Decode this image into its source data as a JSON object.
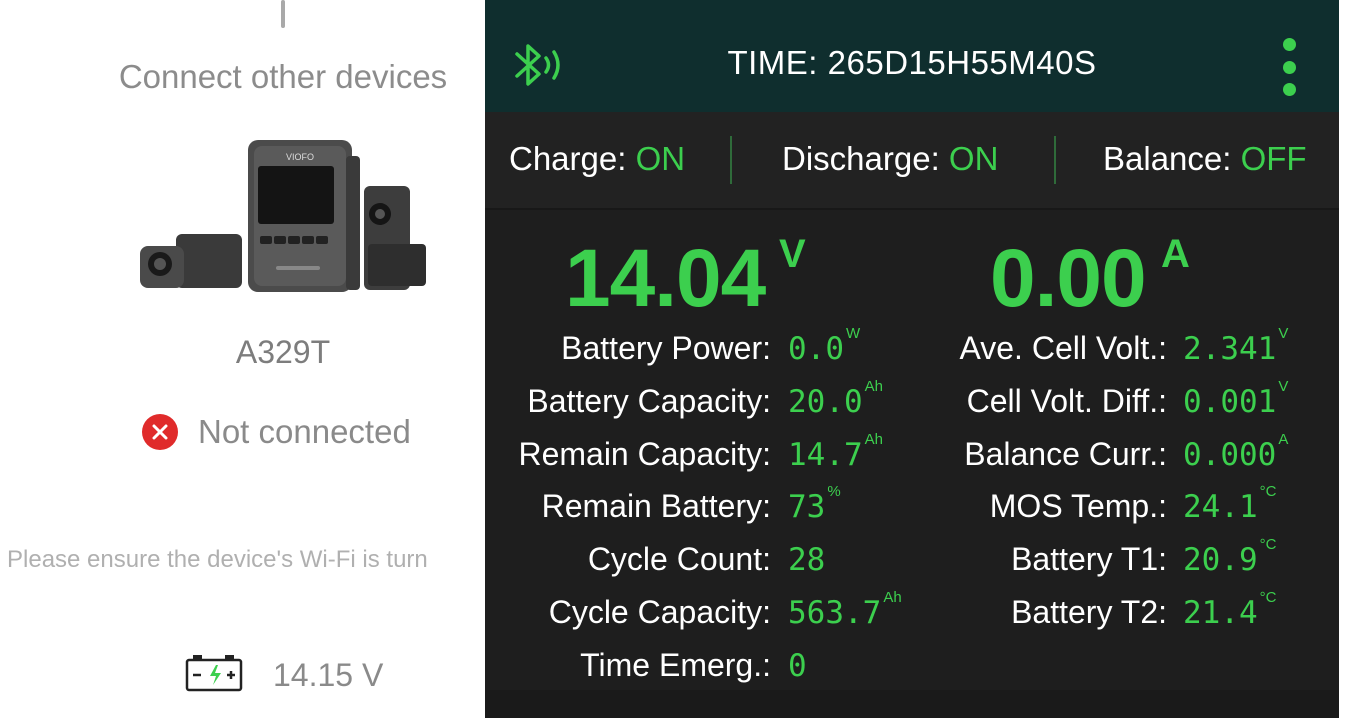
{
  "left_panel": {
    "title": "Connect other devices",
    "model": "A329T",
    "status_text": "Not connected",
    "hint": "Please ensure the device's Wi-Fi is turn",
    "battery_voltage": "14.15 V",
    "camera_brand": "VIOFO",
    "icons": [
      "close-icon",
      "car-battery-icon"
    ]
  },
  "topbar": {
    "time": "TIME: 265D15H55M40S",
    "icons": [
      "bluetooth-icon",
      "more-vert-icon"
    ]
  },
  "status_row": {
    "charge_label": "Charge:",
    "charge_value": "ON",
    "discharge_label": "Discharge:",
    "discharge_value": "ON",
    "balance_label": "Balance:",
    "balance_value": "OFF"
  },
  "readings": {
    "voltage": "14.04",
    "voltage_unit": "V",
    "current": "0.00",
    "current_unit": "A"
  },
  "left_stats": [
    {
      "label": "Battery Power:",
      "value": "0.0",
      "unit": "W"
    },
    {
      "label": "Battery Capacity:",
      "value": "20.0",
      "unit": "Ah"
    },
    {
      "label": "Remain Capacity:",
      "value": "14.7",
      "unit": "Ah"
    },
    {
      "label": "Remain Battery:",
      "value": "73",
      "unit": "%"
    },
    {
      "label": "Cycle Count:",
      "value": "28",
      "unit": ""
    },
    {
      "label": "Cycle Capacity:",
      "value": "563.7",
      "unit": "Ah"
    },
    {
      "label": "Time Emerg.:",
      "value": "0",
      "unit": ""
    }
  ],
  "right_stats": [
    {
      "label": "Ave. Cell Volt.:",
      "value": "2.341",
      "unit": "V"
    },
    {
      "label": "Cell Volt. Diff.:",
      "value": "0.001",
      "unit": "V"
    },
    {
      "label": "Balance Curr.:",
      "value": "0.000",
      "unit": "A"
    },
    {
      "label": "MOS Temp.:",
      "value": "24.1",
      "unit": "°C"
    },
    {
      "label": "Battery T1:",
      "value": "20.9",
      "unit": "°C"
    },
    {
      "label": "Battery T2:",
      "value": "21.4",
      "unit": "°C"
    }
  ],
  "colors": {
    "accent_green": "#3ccf4e",
    "topbar_bg": "#0f2e2e",
    "panel_bg": "#1e1e1e",
    "error_red": "#e02b2b"
  }
}
